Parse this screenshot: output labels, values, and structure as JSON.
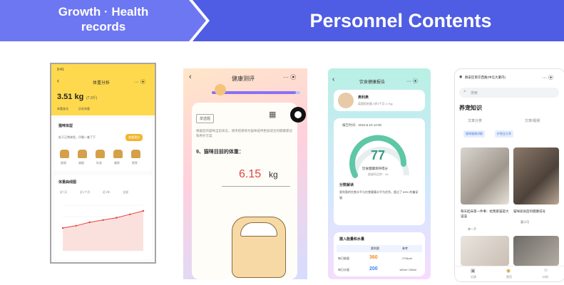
{
  "header": {
    "left_title": "Growth · Health\nrecords",
    "right_title": "Personnel Contents"
  },
  "phone1": {
    "title": "体重分析",
    "weight": "3.51 kg",
    "weight_note": "(7.2斤)",
    "labels": [
      "体重变化",
      "历史体重"
    ],
    "section1": "猫咪体型",
    "hint": "处于正常体型，仔细一查了下",
    "pill": "查看建议",
    "cat_labels": [
      "瘦弱",
      "偏瘦",
      "标准",
      "偏胖",
      "肥胖"
    ],
    "section2": "体重曲线图",
    "tabs": [
      "近7天",
      "近1个月",
      "近1年",
      "全部"
    ],
    "chart_data": {
      "type": "line",
      "x": [
        1,
        2,
        3,
        4,
        5,
        6,
        7
      ],
      "series": [
        {
          "values": [
            2.0,
            2.2,
            2.5,
            2.7,
            2.9,
            3.2,
            3.5
          ]
        }
      ]
    }
  },
  "phone2": {
    "title": "健康测评",
    "chip": "单选题",
    "description": "根据您的猫咪当前状态，测评结果将为猫咪提供更加适合的健康建议和养护方案",
    "question": "9、猫咪目前的体重：",
    "value": "6.15",
    "unit": "kg"
  },
  "phone3": {
    "title": "饮食健康报告",
    "pet_name": "奥利奥",
    "pet_info": "英国短毛猫  3岁2个月  4.7kg",
    "report_time": "报告时间：2023.6.10  12:00",
    "score": "77",
    "score_label": "饮食健康测评得分",
    "score_sub": "超越同品种：48",
    "analysis_title": "分数解读",
    "analysis_text": "奥利奥的饮食水平与饮食健康水平为优秀，超过了 89% 的養宠猫",
    "table_title": "摄入能量和水量",
    "table_headers": [
      "",
      "奥利奥",
      "参考"
    ],
    "rows": [
      {
        "label": "每日能量",
        "value": "360",
        "ref": "270kcal"
      },
      {
        "label": "每日水量",
        "value": "200",
        "ref": "180ml~280ml"
      }
    ]
  },
  "phone4": {
    "location": "静安区南京西路(中信大厦内)",
    "search": "搜索",
    "section": "养宠知识",
    "filters": [
      "文章分类",
      "文章/视频"
    ],
    "tags": [
      "猫咪健康讲解",
      "护理全分享"
    ],
    "articles": [
      {
        "title": "每天起床第一件事：给我家猫搓大澡澡",
        "author": "李一子"
      },
      {
        "title": "猫咪尿尿后的健康说号",
        "author": "喜小可"
      }
    ],
    "tabbar": [
      "记录",
      "首页",
      "TA的"
    ]
  },
  "colors": {
    "header_left": "#6d77f2",
    "header_right": "#4f5ce4",
    "yellow": "#ffd94d",
    "red": "#e2433d",
    "mint": "#5ec7a6"
  }
}
